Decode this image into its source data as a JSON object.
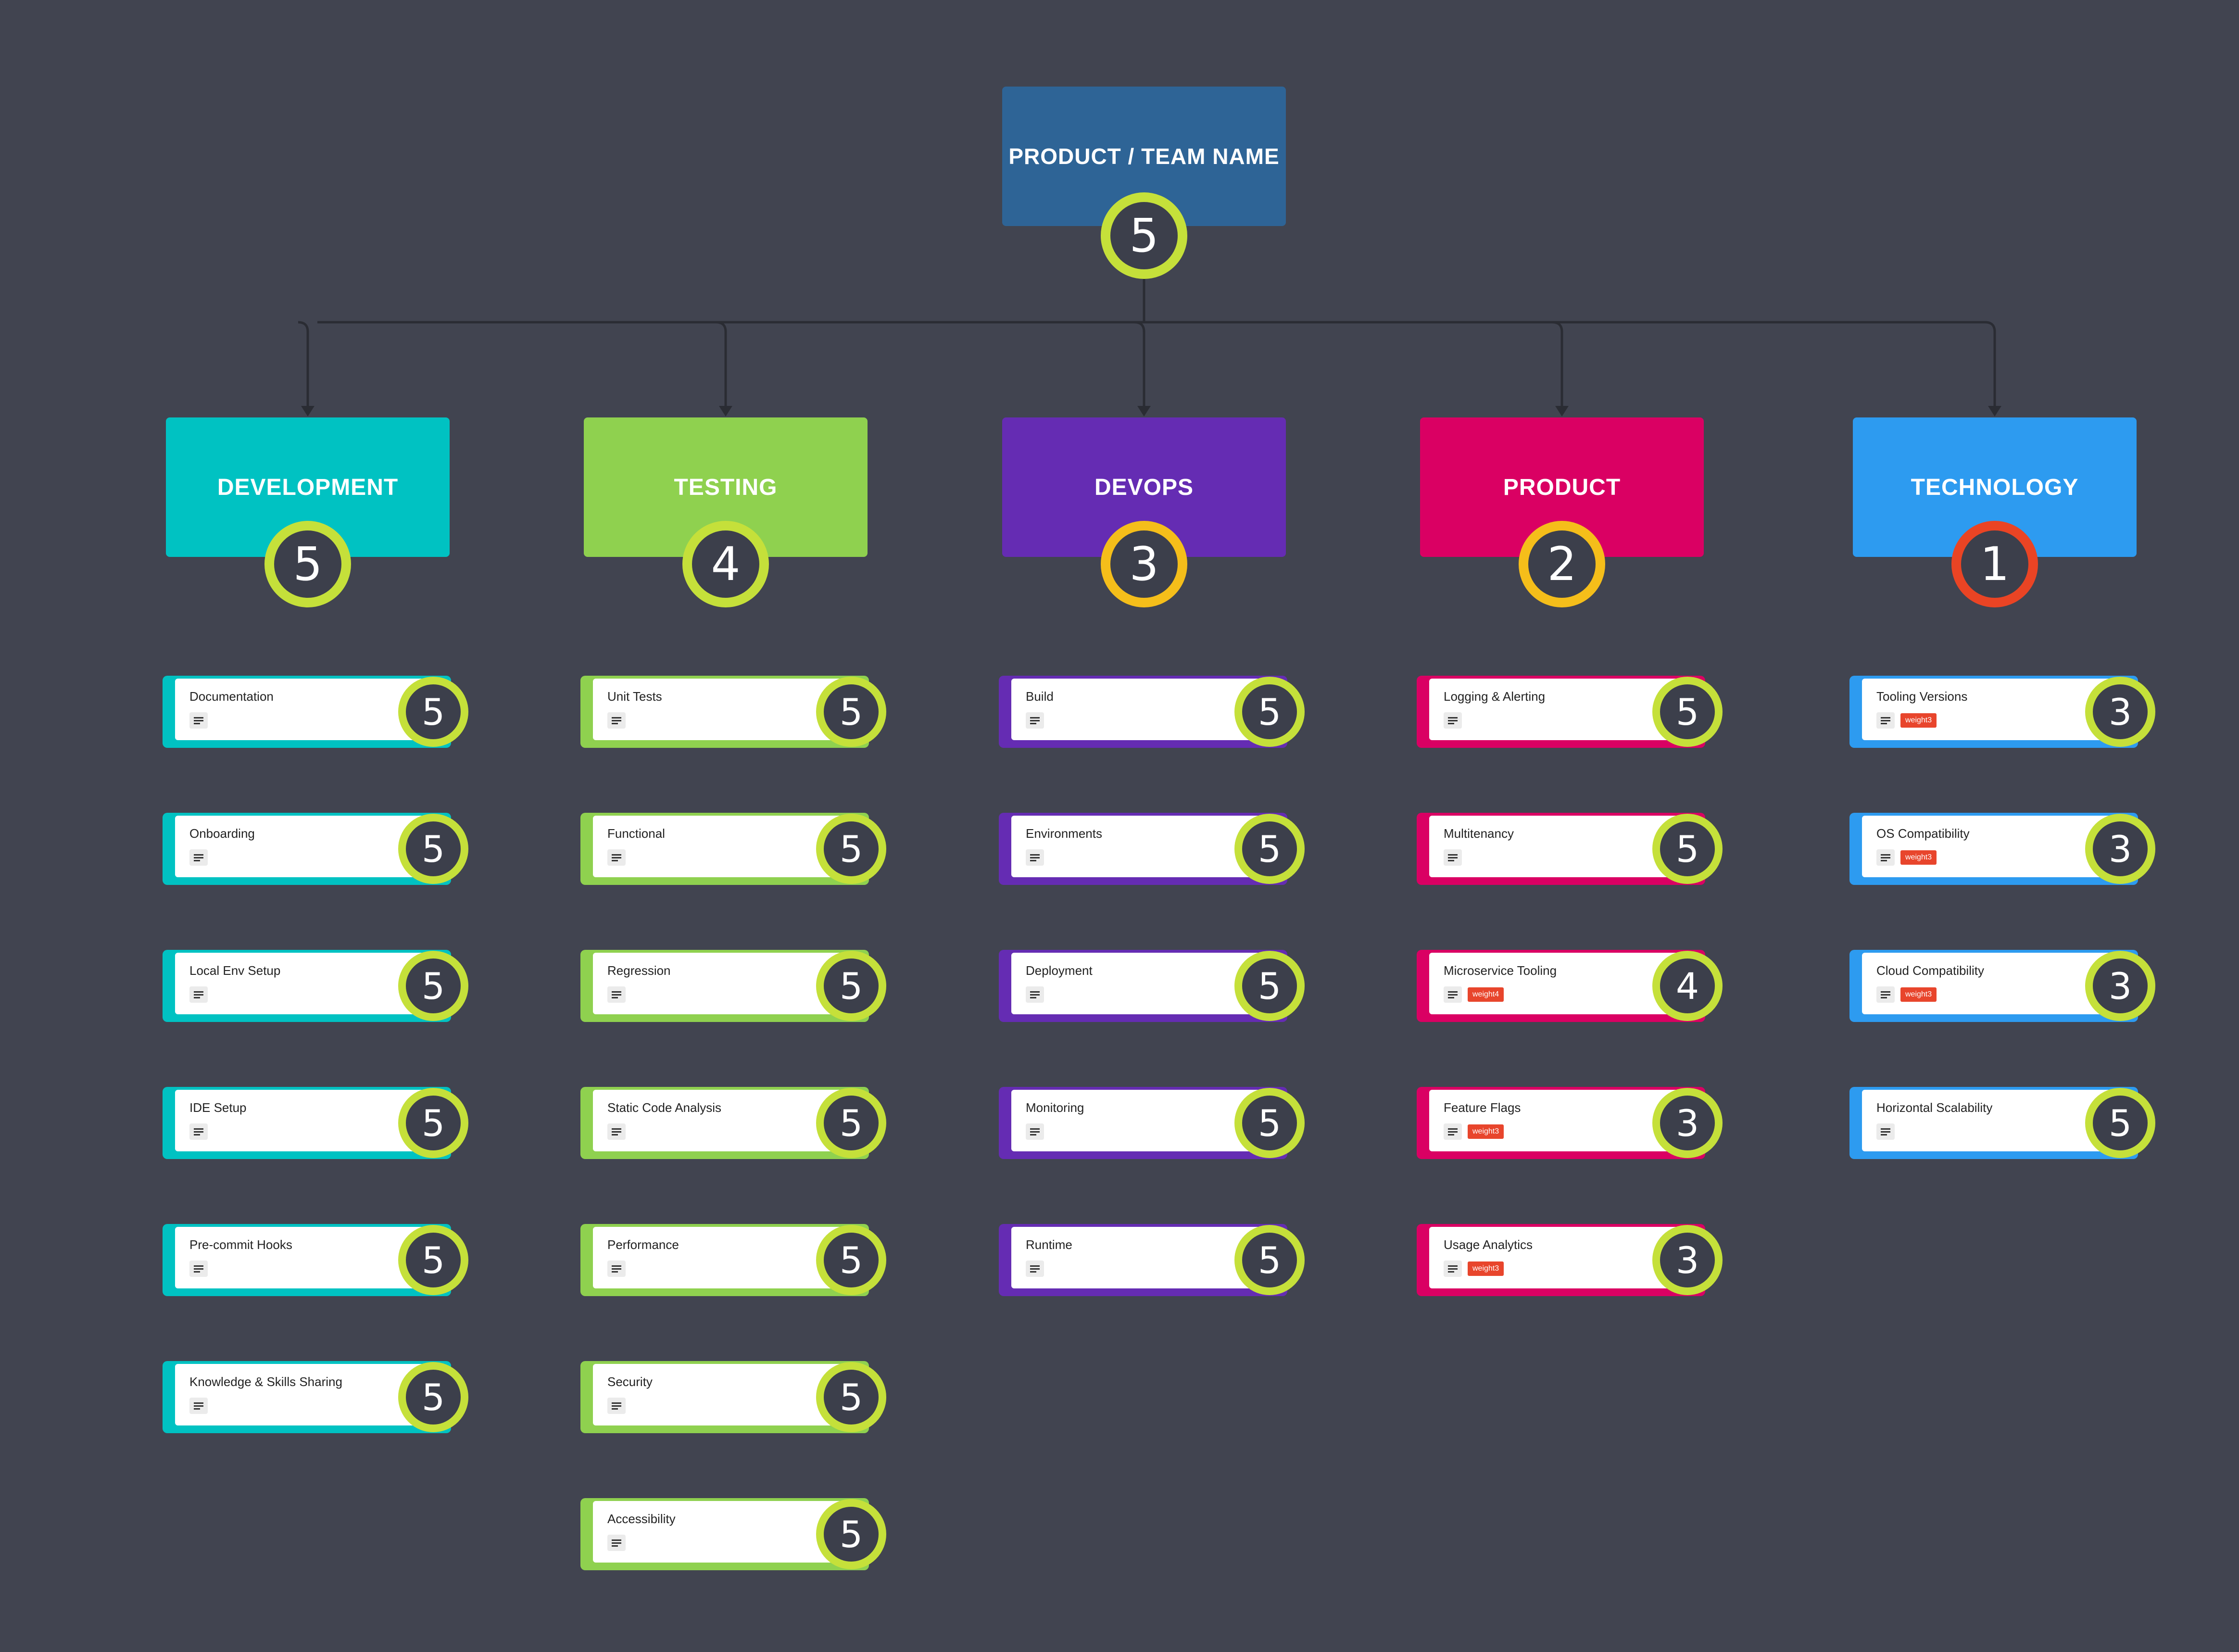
{
  "colors": {
    "background": "#414450",
    "connector": "#2a2c33",
    "score_good": "#c5e03a",
    "score_warn": "#f5be1a",
    "score_bad": "#ea4424",
    "tag": "#e8452c"
  },
  "root": {
    "title": "PRODUCT / TEAM NAME",
    "score": "5",
    "color": "#2e6496",
    "ring": "#c5e03a"
  },
  "categories": [
    {
      "title": "DEVELOPMENT",
      "score": "5",
      "color": "#00c2c2",
      "ring": "#c5e03a",
      "items": [
        {
          "label": "Documentation",
          "score": "5",
          "tag": ""
        },
        {
          "label": "Onboarding",
          "score": "5",
          "tag": ""
        },
        {
          "label": "Local Env Setup",
          "score": "5",
          "tag": ""
        },
        {
          "label": "IDE Setup",
          "score": "5",
          "tag": ""
        },
        {
          "label": "Pre-commit Hooks",
          "score": "5",
          "tag": ""
        },
        {
          "label": "Knowledge & Skills Sharing",
          "score": "5",
          "tag": ""
        }
      ]
    },
    {
      "title": "TESTING",
      "score": "4",
      "color": "#8fd14f",
      "ring": "#c5e03a",
      "items": [
        {
          "label": "Unit Tests",
          "score": "5",
          "tag": ""
        },
        {
          "label": "Functional",
          "score": "5",
          "tag": ""
        },
        {
          "label": "Regression",
          "score": "5",
          "tag": ""
        },
        {
          "label": "Static Code Analysis",
          "score": "5",
          "tag": ""
        },
        {
          "label": "Performance",
          "score": "5",
          "tag": ""
        },
        {
          "label": "Security",
          "score": "5",
          "tag": ""
        },
        {
          "label": "Accessibility",
          "score": "5",
          "tag": ""
        }
      ]
    },
    {
      "title": "DEVOPS",
      "score": "3",
      "color": "#652cb3",
      "ring": "#f5be1a",
      "items": [
        {
          "label": "Build",
          "score": "5",
          "tag": ""
        },
        {
          "label": "Environments",
          "score": "5",
          "tag": ""
        },
        {
          "label": "Deployment",
          "score": "5",
          "tag": ""
        },
        {
          "label": "Monitoring",
          "score": "5",
          "tag": ""
        },
        {
          "label": "Runtime",
          "score": "5",
          "tag": ""
        }
      ]
    },
    {
      "title": "PRODUCT",
      "score": "2",
      "color": "#da0063",
      "ring": "#f5be1a",
      "items": [
        {
          "label": "Logging & Alerting",
          "score": "5",
          "tag": ""
        },
        {
          "label": "Multitenancy",
          "score": "5",
          "tag": ""
        },
        {
          "label": "Microservice Tooling",
          "score": "4",
          "tag": "weight4"
        },
        {
          "label": "Feature Flags",
          "score": "3",
          "tag": "weight3"
        },
        {
          "label": "Usage Analytics",
          "score": "3",
          "tag": "weight3"
        }
      ]
    },
    {
      "title": "TECHNOLOGY",
      "score": "1",
      "color": "#2d9bf0",
      "ring": "#ea4424",
      "items": [
        {
          "label": "Tooling Versions",
          "score": "3",
          "tag": "weight3"
        },
        {
          "label": "OS Compatibility",
          "score": "3",
          "tag": "weight3"
        },
        {
          "label": "Cloud Compatibility",
          "score": "3",
          "tag": "weight3"
        },
        {
          "label": "Horizontal Scalability",
          "score": "5",
          "tag": ""
        }
      ]
    }
  ]
}
